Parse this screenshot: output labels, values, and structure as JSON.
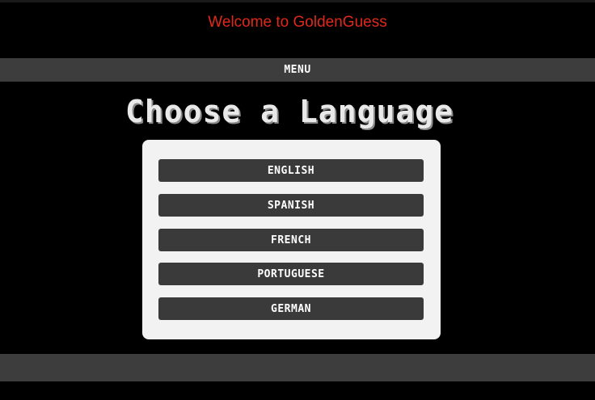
{
  "header": {
    "title": "Welcome to GoldenGuess"
  },
  "menu": {
    "label": "MENU"
  },
  "main": {
    "heading": "Choose a Language",
    "languages": [
      "ENGLISH",
      "SPANISH",
      "FRENCH",
      "PORTUGUESE",
      "GERMAN"
    ]
  },
  "colors": {
    "title": "#e0281b",
    "bar": "#3d3d3d",
    "panel": "#f2f2f2",
    "button": "#3a3a3a",
    "background": "#000000"
  }
}
